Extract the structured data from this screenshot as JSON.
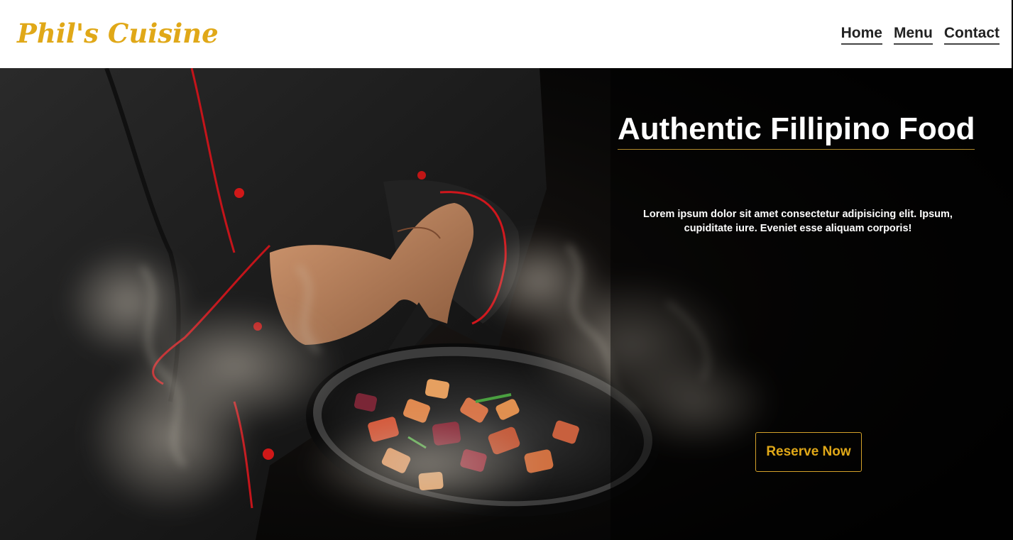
{
  "brand": {
    "name": "Phil's Cuisine",
    "accent_color": "#e0a818"
  },
  "nav": {
    "links": [
      {
        "label": "Home"
      },
      {
        "label": "Menu"
      },
      {
        "label": "Contact"
      }
    ]
  },
  "hero": {
    "title": "Authentic Fillipino Food",
    "text": "Lorem ipsum dolor sit amet consectetur adipisicing elit. Ipsum, cupiditate iure. Eveniet esse aliquam corporis!",
    "cta_label": "Reserve Now",
    "image_subject": "chef tossing vegetables in a smoking pan"
  }
}
